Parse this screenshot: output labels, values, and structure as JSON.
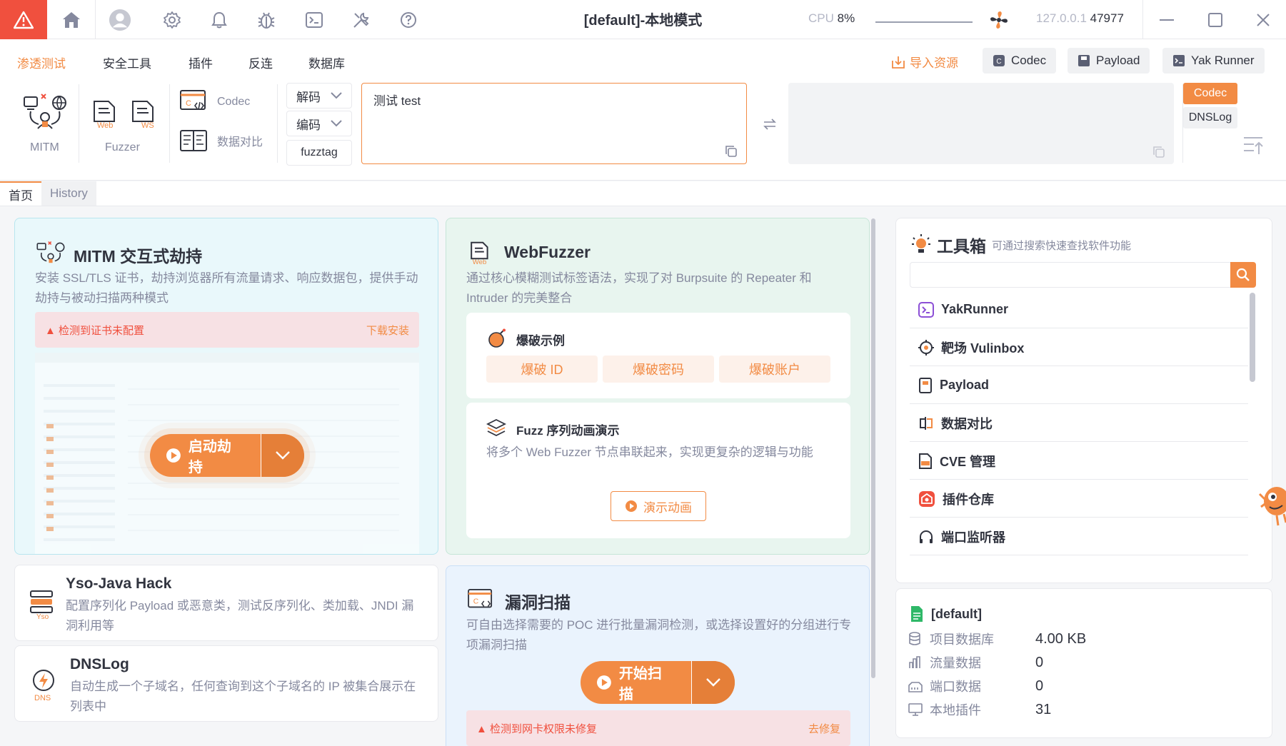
{
  "titlebar": {
    "title": "[default]-本地模式",
    "cpu_label": "CPU",
    "cpu_value": "8%",
    "ip": "127.0.0.1",
    "port": "47977"
  },
  "menu": {
    "items": [
      "渗透测试",
      "安全工具",
      "插件",
      "反连",
      "数据库"
    ],
    "import_label": "导入资源",
    "codec_btn": "Codec",
    "payload_btn": "Payload",
    "yakrunner_btn": "Yak Runner"
  },
  "toolbar": {
    "mitm_label": "MITM",
    "fuzzer_label": "Fuzzer",
    "web_tag": "Web",
    "ws_tag": "WS",
    "codec_label": "Codec",
    "diff_label": "数据对比",
    "decode_label": "解码",
    "encode_label": "编码",
    "fuzztag_label": "fuzztag",
    "input_value": "测试 test",
    "side_codec": "Codec",
    "side_dnslog": "DNSLog"
  },
  "tabs": [
    "首页",
    "History"
  ],
  "mitm_card": {
    "title": "MITM 交互式劫持",
    "desc": "安装 SSL/TLS 证书，劫持浏览器所有流量请求、响应数据包，提供手动劫持与被动扫描两种模式",
    "alert": "检测到证书未配置",
    "alert_action": "下载安装",
    "start_btn": "启动劫持"
  },
  "webfuzzer_card": {
    "title": "WebFuzzer",
    "desc": "通过核心模糊测试标签语法，实现了对 Burpsuite 的 Repeater 和 Intruder 的完美整合",
    "brute_title": "爆破示例",
    "chips": [
      "爆破 ID",
      "爆破密码",
      "爆破账户"
    ],
    "seq_title": "Fuzz 序列动画演示",
    "seq_desc": "将多个 Web Fuzzer 节点串联起来，实现更复杂的逻辑与功能",
    "demo_btn": "演示动画"
  },
  "yso_card": {
    "title": "Yso-Java Hack",
    "desc": "配置序列化 Payload 或恶意类，测试反序列化、类加载、JNDI 漏洞利用等",
    "tag": "Yso"
  },
  "dnslog_card": {
    "title": "DNSLog",
    "desc": "自动生成一个子域名，任何查询到这个子域名的 IP 被集合展示在列表中",
    "tag": "DNS"
  },
  "vuln_card": {
    "title": "漏洞扫描",
    "desc": "可自由选择需要的 POC 进行批量漏洞检测，或选择设置好的分组进行专项漏洞扫描",
    "start_btn": "开始扫描",
    "alert": "检测到网卡权限未修复",
    "alert_action": "去修复"
  },
  "toolbox": {
    "title": "工具箱",
    "subtitle": "可通过搜索快速查找软件功能",
    "search_placeholder": "",
    "items": [
      "YakRunner",
      "靶场 Vulinbox",
      "Payload",
      "数据对比",
      "CVE 管理",
      "插件仓库",
      "端口监听器"
    ]
  },
  "project": {
    "name": "[default]",
    "rows": [
      {
        "label": "项目数据库",
        "value": "4.00 KB"
      },
      {
        "label": "流量数据",
        "value": "0"
      },
      {
        "label": "端口数据",
        "value": "0"
      },
      {
        "label": "本地插件",
        "value": "31"
      }
    ]
  },
  "colors": {
    "accent": "#f28b44",
    "danger": "#f0503e",
    "text": "#31343f",
    "muted": "#85899e"
  }
}
